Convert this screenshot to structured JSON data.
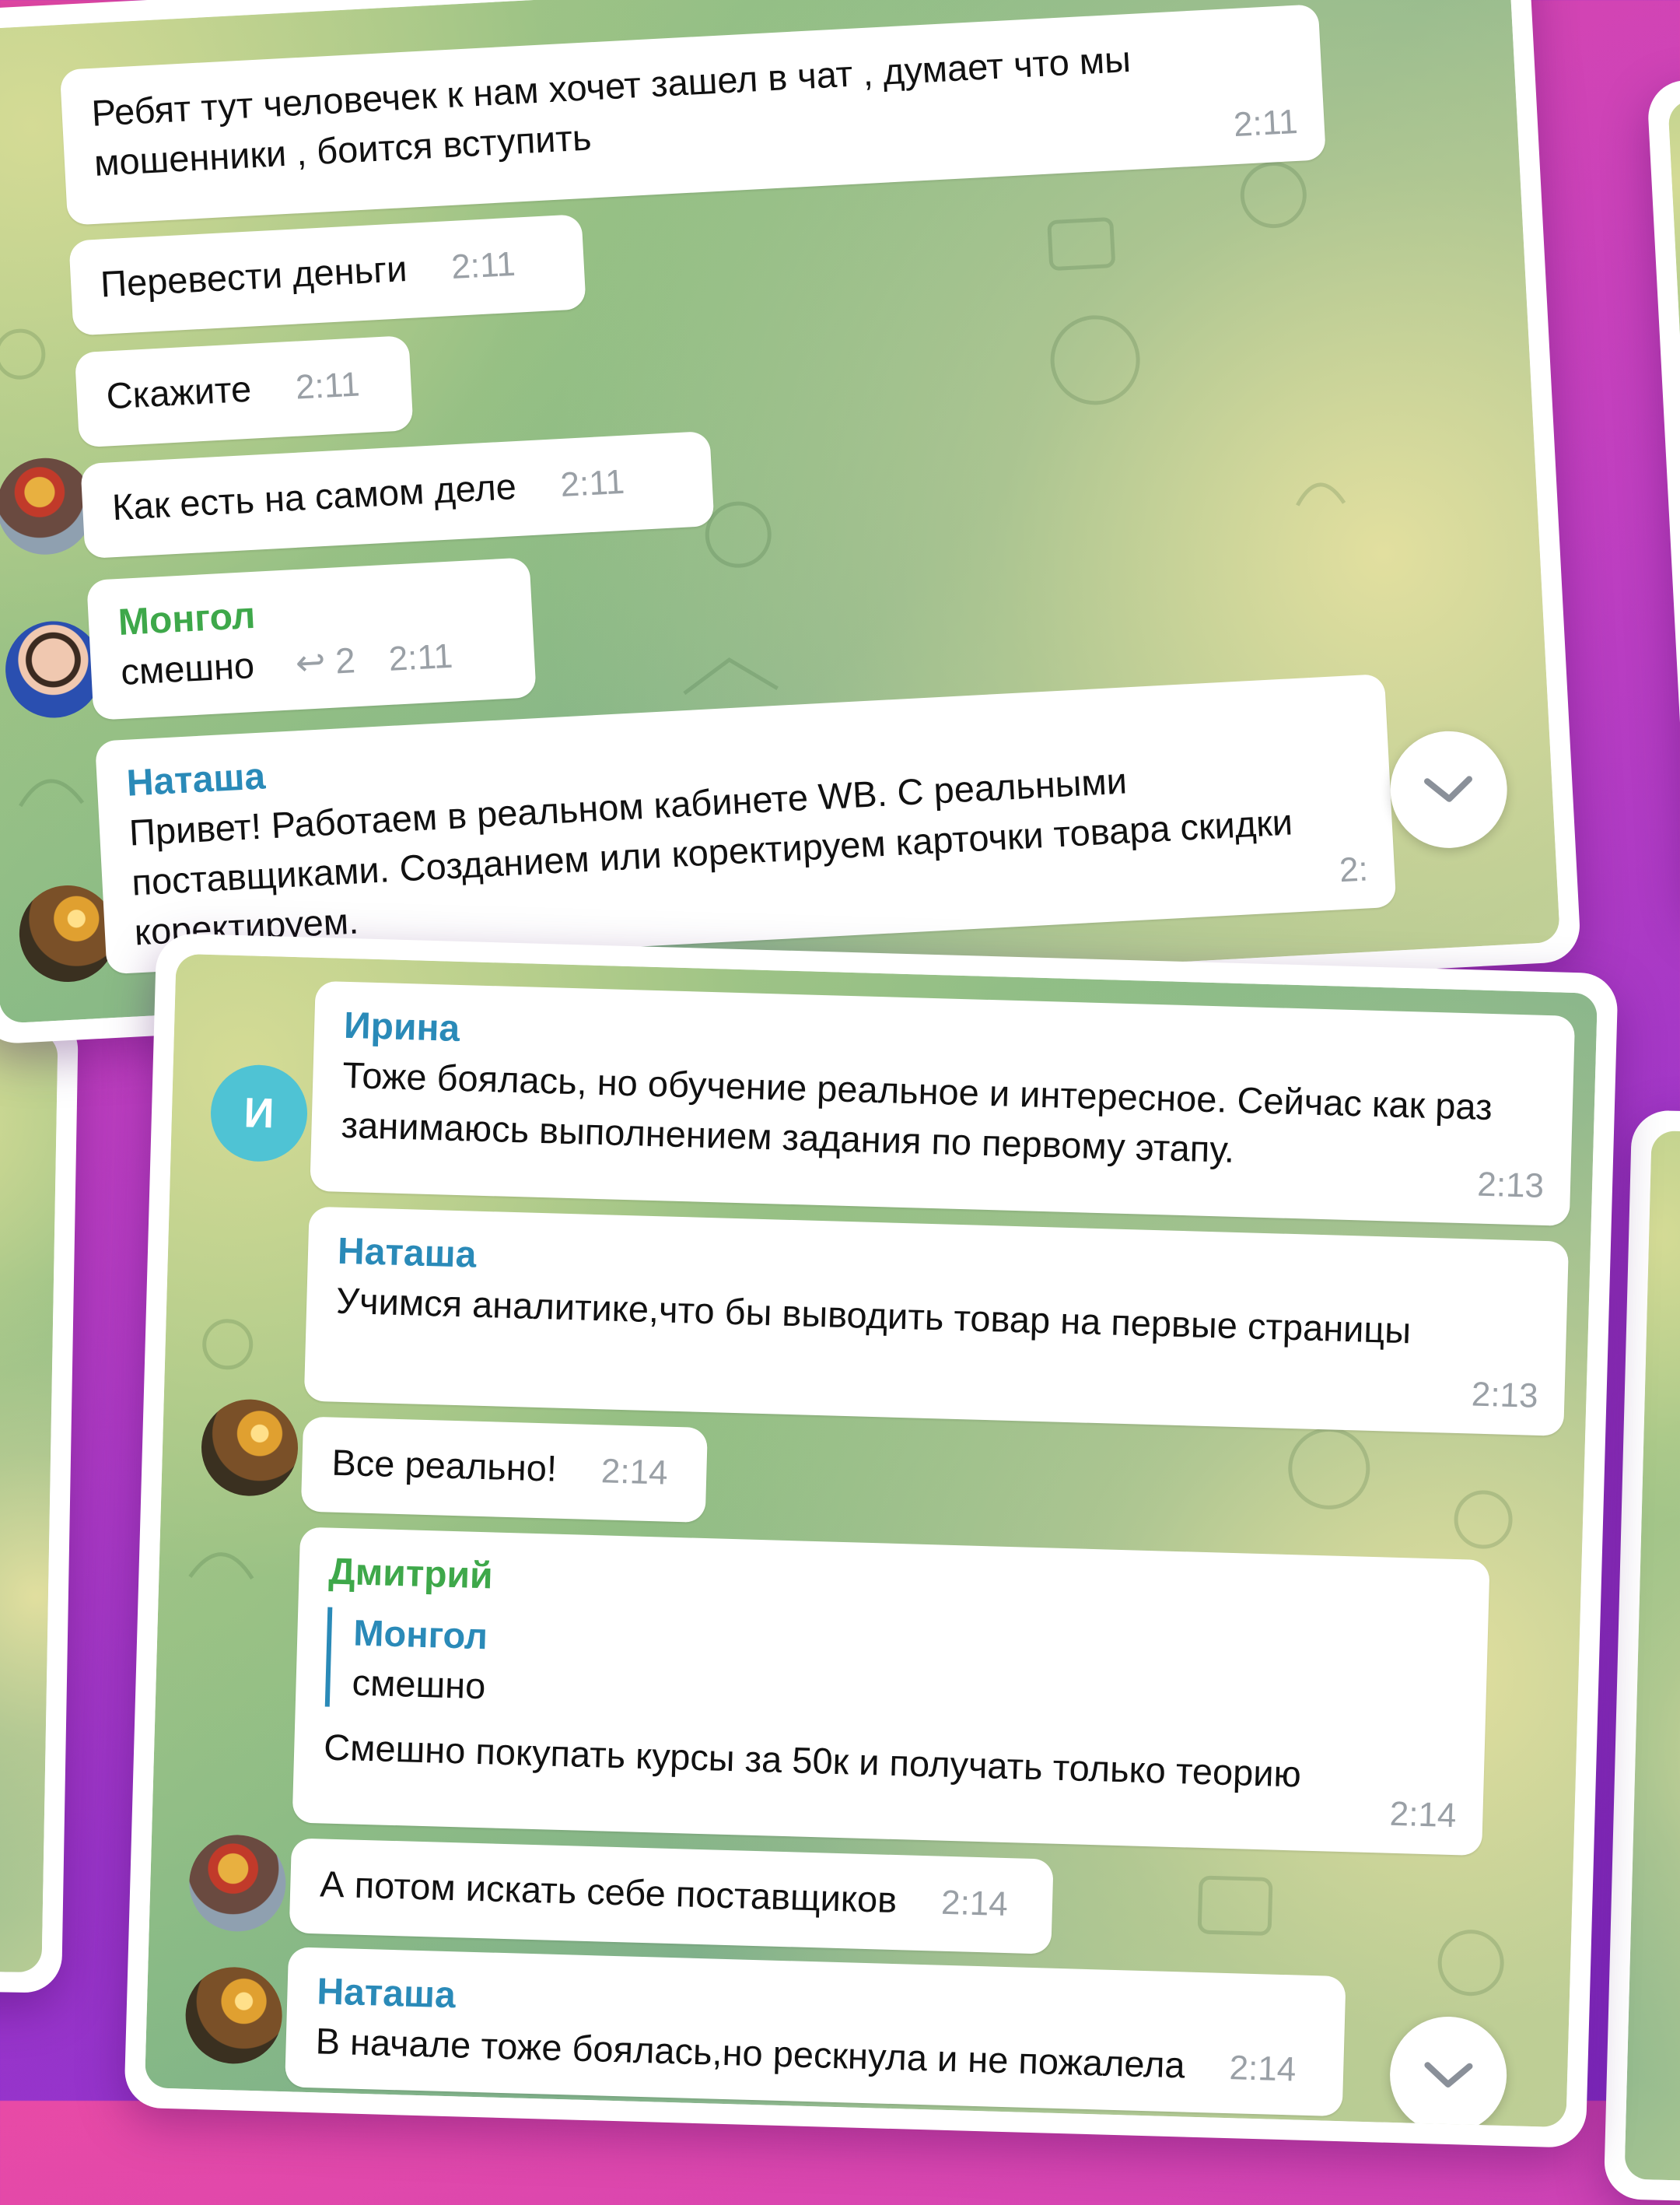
{
  "chat1": {
    "messages": [
      {
        "text": "Ребят тут человечек к нам хочет зашел в чат , думает что мы мошенники , боится вступить",
        "time": "2:11"
      },
      {
        "text": "Перевести деньги",
        "time": "2:11"
      },
      {
        "text": "Скажите",
        "time": "2:11"
      },
      {
        "text": "Как есть на самом деле",
        "time": "2:11"
      },
      {
        "sender": "Монгол",
        "text": "смешно",
        "replies": "2",
        "time": "2:11"
      },
      {
        "sender": "Наташа",
        "text": "Привет! Работаем в реальном кабинете WB. С реальными поставщиками. Созданием или коректируем карточки товара скидки коректируем.",
        "time": "2:"
      }
    ]
  },
  "chat2": {
    "messages": [
      {
        "sender": "Ирина",
        "avatar_letter": "И",
        "text": "Тоже боялась, но обучение реальное и интересное. Сейчас как раз занимаюсь выполнением задания по первому этапу.",
        "time": "2:13"
      },
      {
        "sender": "Наташа",
        "text": "Учимся аналитике,что бы выводить товар на первые страницы",
        "time": "2:13"
      },
      {
        "text": "Все реально!",
        "time": "2:14"
      },
      {
        "sender": "Дмитрий",
        "quote_sender": "Монгол",
        "quote_text": "смешно",
        "text": "Смешно покупать курсы за 50к и получать только теорию",
        "time": "2:14"
      },
      {
        "text": "А потом искать себе поставщиков",
        "time": "2:14"
      },
      {
        "sender": "Наташа",
        "text": "В начале тоже боялась,но рескнула  и не пожалела",
        "time": "2:14"
      }
    ]
  },
  "icons": {
    "scroll_down": "chevron-down-icon",
    "reply": "reply-arrow-icon"
  },
  "colors": {
    "background_top": "#e84aa6",
    "background_bottom": "#8a2fd0",
    "sender_green": "#3ea84a",
    "sender_blue": "#2a8ab8",
    "avatar_irina": "#4fc3d4"
  }
}
